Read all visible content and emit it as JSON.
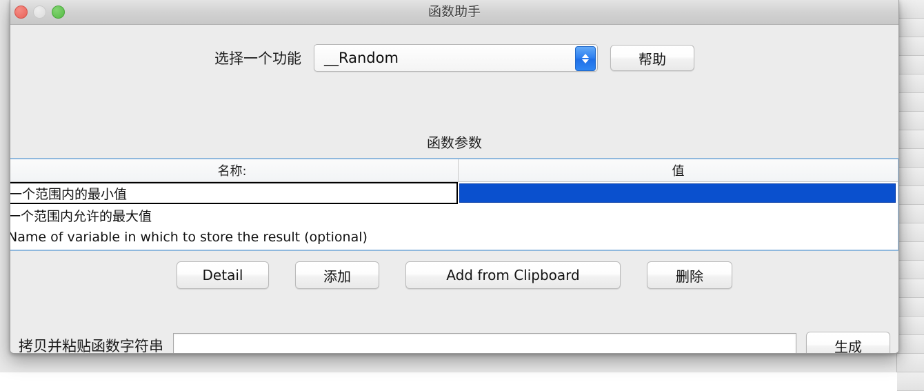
{
  "window": {
    "title": "函数助手",
    "controls": {
      "close": "close-button",
      "minimize": "minimize-button",
      "zoom": "zoom-button"
    }
  },
  "function_select": {
    "label": "选择一个功能",
    "selected_value": "__Random",
    "stepper_icon": "chevron-up-down-icon",
    "help_label": "帮助"
  },
  "parameters_section": {
    "title": "函数参数",
    "columns": [
      "名称:",
      "值"
    ],
    "rows": [
      {
        "name": "一个范围内的最小值",
        "value": "",
        "editing": true
      },
      {
        "name": "一个范围内允许的最大值",
        "value": "",
        "editing": false
      },
      {
        "name": "Name of variable in which to store the result (optional)",
        "value": "",
        "editing": false
      }
    ]
  },
  "actions": {
    "detail": "Detail",
    "add": "添加",
    "add_from_clipboard": "Add from Clipboard",
    "delete": "删除"
  },
  "footer": {
    "paste_label": "拷贝并粘贴函数字符串",
    "function_string_value": "",
    "function_string_placeholder": "",
    "generate_label": "生成"
  },
  "colors": {
    "selection_blue": "#0A50CE",
    "stepper_blue": "#2C7EF0",
    "table_focus_border": "#8FB8DD",
    "window_chrome": "#ECECEC"
  }
}
